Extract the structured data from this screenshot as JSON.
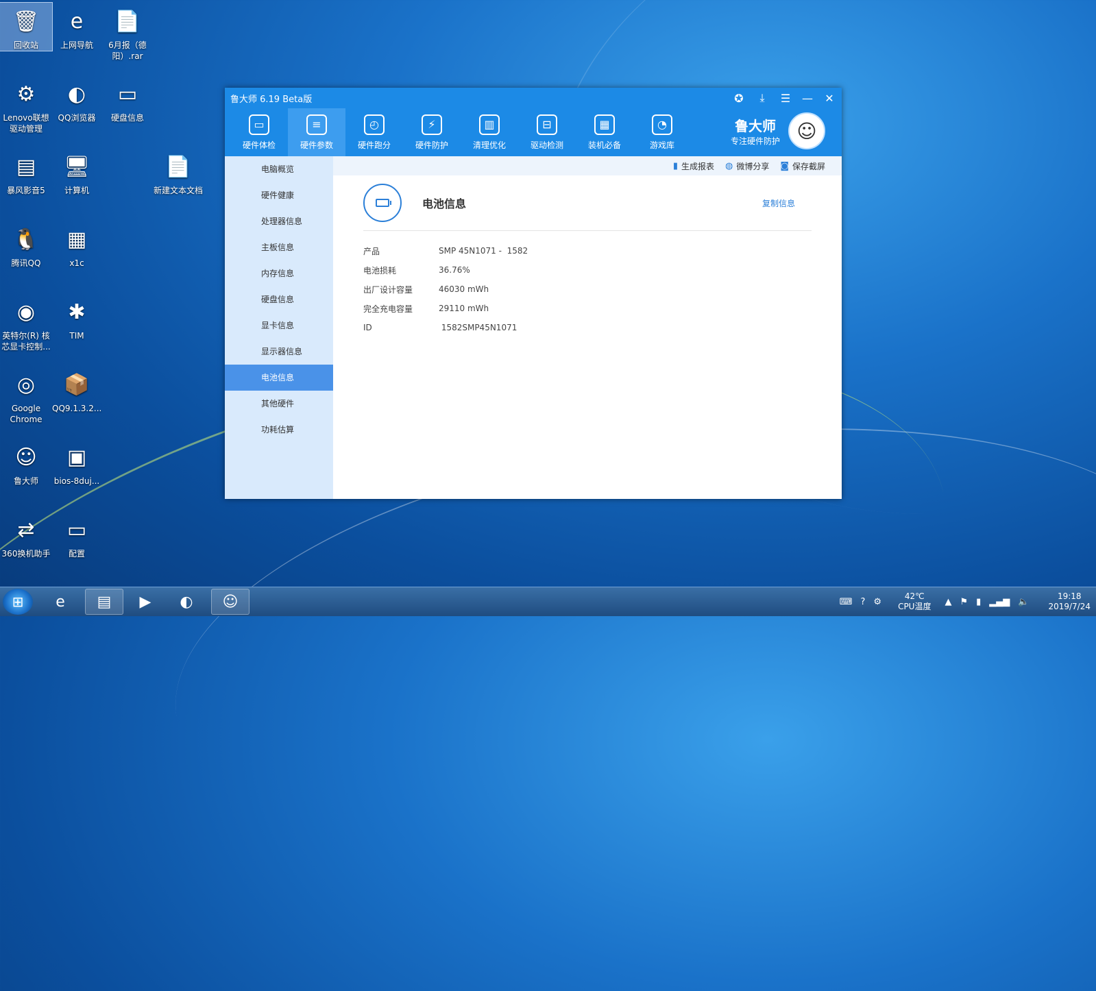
{
  "desktop": {
    "icons": [
      {
        "label": "回收站",
        "icon": "recycle-bin-icon",
        "glyph": "🗑"
      },
      {
        "label": "上网导航",
        "icon": "ie-icon",
        "glyph": "e"
      },
      {
        "label": "6月报（德阳）.rar",
        "icon": "file-icon",
        "glyph": "📄"
      },
      {
        "label": "Lenovo联想驱动管理",
        "icon": "lenovo-icon",
        "glyph": "⚙"
      },
      {
        "label": "QQ浏览器",
        "icon": "qq-browser-icon",
        "glyph": "◐"
      },
      {
        "label": "硬盘信息",
        "icon": "disk-icon",
        "glyph": "▭"
      },
      {
        "label": "暴风影音5",
        "icon": "storm-player-icon",
        "glyph": "▤"
      },
      {
        "label": "计算机",
        "icon": "computer-icon",
        "glyph": "🖥"
      },
      {
        "label": "新建文本文档",
        "icon": "text-doc-icon",
        "glyph": "📄"
      },
      {
        "label": "腾讯QQ",
        "icon": "qq-icon",
        "glyph": "🐧"
      },
      {
        "label": "x1c",
        "icon": "x1c-icon",
        "glyph": "▦"
      },
      {
        "label": "英特尔(R) 核芯显卡控制...",
        "icon": "intel-icon",
        "glyph": "◉"
      },
      {
        "label": "TIM",
        "icon": "tim-icon",
        "glyph": "✱"
      },
      {
        "label": "Google Chrome",
        "icon": "chrome-icon",
        "glyph": "◎"
      },
      {
        "label": "QQ9.1.3.2...",
        "icon": "qq-installer-icon",
        "glyph": "📦"
      },
      {
        "label": "鲁大师",
        "icon": "ludashi-icon",
        "glyph": "☺"
      },
      {
        "label": "bios-8duj...",
        "icon": "bios-icon",
        "glyph": "▣"
      },
      {
        "label": "360换机助手",
        "icon": "360-icon",
        "glyph": "⇄"
      },
      {
        "label": "配置",
        "icon": "config-icon",
        "glyph": "▭"
      }
    ]
  },
  "window": {
    "title": "鲁大师 6.19 Beta版",
    "controls": {
      "medal": "medal-icon",
      "download": "download-icon",
      "menu": "menu-icon",
      "minimize": "minimize-icon",
      "close": "close-icon"
    },
    "brand": {
      "name": "鲁大师",
      "slogan": "专注硬件防护"
    },
    "tools": [
      {
        "label": "硬件体检",
        "icon": "monitor-icon",
        "glyph": "▭"
      },
      {
        "label": "硬件参数",
        "icon": "list-icon",
        "glyph": "≡"
      },
      {
        "label": "硬件跑分",
        "icon": "gauge-icon",
        "glyph": "◴"
      },
      {
        "label": "硬件防护",
        "icon": "shield-icon",
        "glyph": "⚡"
      },
      {
        "label": "清理优化",
        "icon": "broom-icon",
        "glyph": "▥"
      },
      {
        "label": "驱动检测",
        "icon": "toolbox-icon",
        "glyph": "⊟"
      },
      {
        "label": "装机必备",
        "icon": "apps-icon",
        "glyph": "▦"
      },
      {
        "label": "游戏库",
        "icon": "gamepad-icon",
        "glyph": "◔"
      }
    ],
    "active_tool": "硬件参数",
    "sidebar": [
      {
        "label": "电脑概览"
      },
      {
        "label": "硬件健康"
      },
      {
        "label": "处理器信息"
      },
      {
        "label": "主板信息"
      },
      {
        "label": "内存信息"
      },
      {
        "label": "硬盘信息"
      },
      {
        "label": "显卡信息"
      },
      {
        "label": "显示器信息"
      },
      {
        "label": "电池信息"
      },
      {
        "label": "其他硬件"
      },
      {
        "label": "功耗估算"
      }
    ],
    "active_sidebar": "电池信息",
    "actions": [
      {
        "label": "生成报表",
        "icon": "chart-icon",
        "glyph": "▮"
      },
      {
        "label": "微博分享",
        "icon": "weibo-icon",
        "glyph": "◍"
      },
      {
        "label": "保存截屏",
        "icon": "camera-icon",
        "glyph": "◙"
      }
    ],
    "section_title": "电池信息",
    "copy_label": "复制信息",
    "battery": [
      {
        "key": "产品",
        "value": "SMP 45N1071 -  1582"
      },
      {
        "key": "电池损耗",
        "value": "36.76%"
      },
      {
        "key": "出厂设计容量",
        "value": "46030 mWh"
      },
      {
        "key": "完全充电容量",
        "value": "29110 mWh"
      },
      {
        "key": "ID",
        "value": " 1582SMP45N1071"
      }
    ]
  },
  "taskbar": {
    "apps": [
      {
        "name": "ie-icon",
        "glyph": "e"
      },
      {
        "name": "explorer-icon",
        "glyph": "▤"
      },
      {
        "name": "media-player-icon",
        "glyph": "▶"
      },
      {
        "name": "qq-browser-icon",
        "glyph": "◐"
      },
      {
        "name": "ludashi-icon",
        "glyph": "☺"
      }
    ],
    "temperature": "42℃",
    "temperature_label": "CPU温度",
    "time": "19:18",
    "date": "2019/7/24"
  }
}
